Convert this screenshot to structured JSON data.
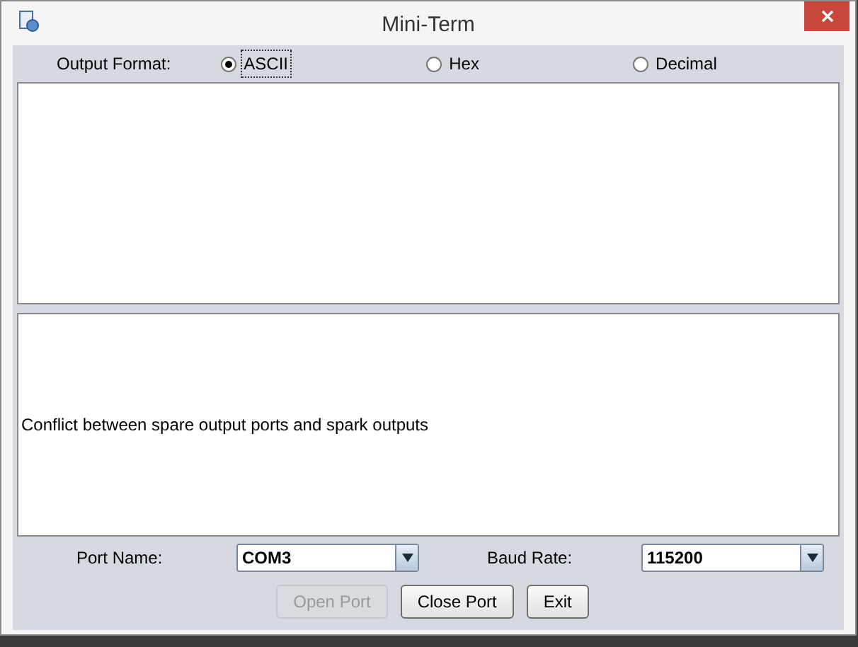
{
  "window": {
    "title": "Mini-Term"
  },
  "output_format": {
    "label": "Output Format:",
    "options": [
      {
        "label": "ASCII",
        "selected": true
      },
      {
        "label": "Hex",
        "selected": false
      },
      {
        "label": "Decimal",
        "selected": false
      }
    ]
  },
  "message_area": {
    "text": "Conflict between spare output ports and spark outputs"
  },
  "port_name": {
    "label": "Port Name:",
    "value": "COM3"
  },
  "baud_rate": {
    "label": "Baud Rate:",
    "value": "115200"
  },
  "buttons": [
    {
      "label": "Open Port",
      "disabled": true
    },
    {
      "label": "Close Port",
      "disabled": false
    },
    {
      "label": "Exit",
      "disabled": false
    }
  ]
}
